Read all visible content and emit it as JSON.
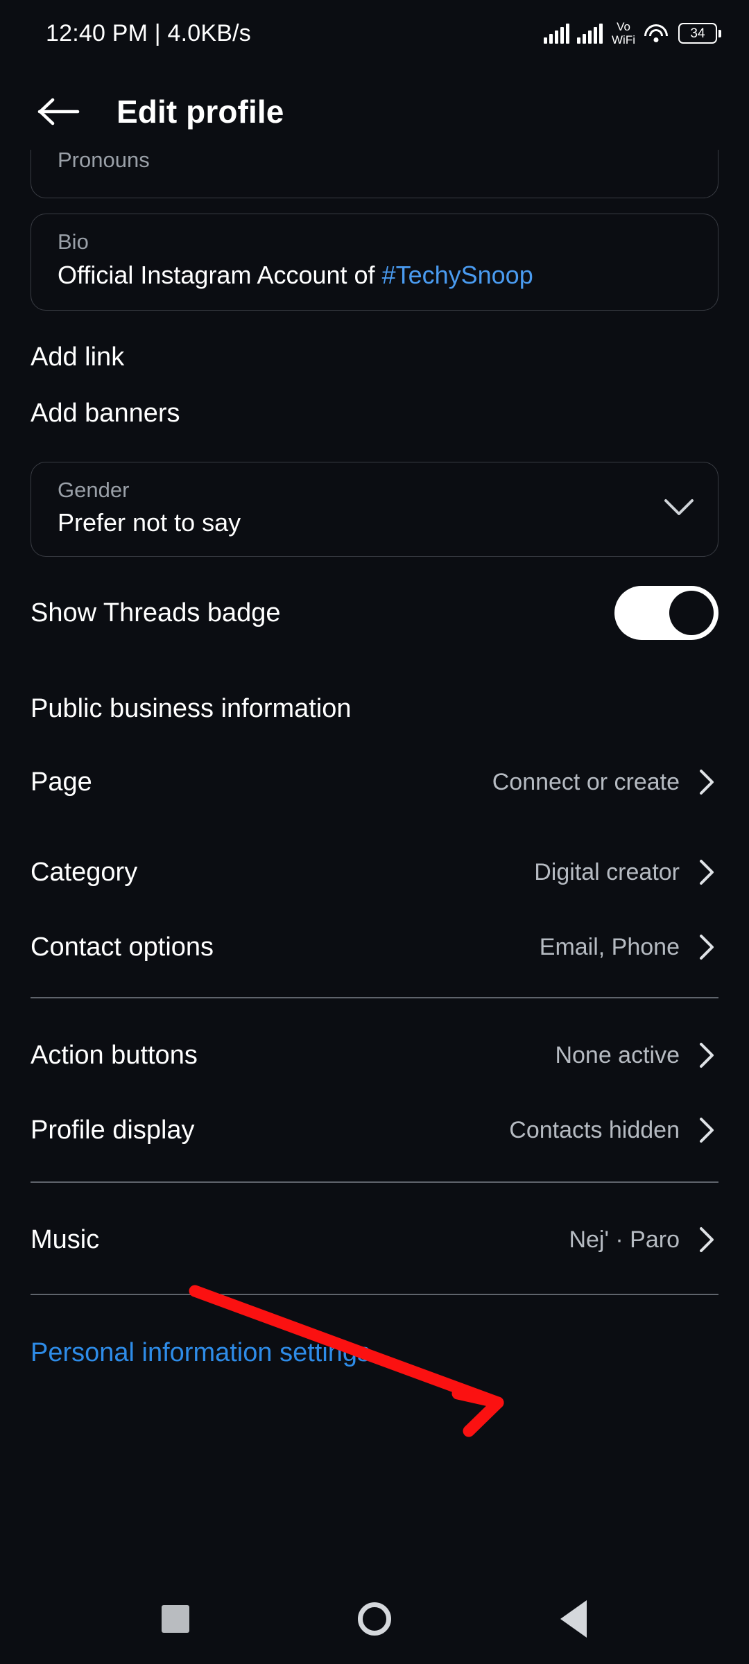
{
  "statusbar": {
    "left_text": "12:40 PM | 4.0KB/s",
    "volte_line1": "Vo",
    "volte_line2": "WiFi",
    "battery_level": "34"
  },
  "header": {
    "title": "Edit profile",
    "back_icon": "back-arrow-icon"
  },
  "form": {
    "pronouns": {
      "label": "Pronouns",
      "value": ""
    },
    "bio": {
      "label": "Bio",
      "value_text": "Official Instagram Account of ",
      "value_hashtag": "#TechySnoop",
      "hashtag_color": "#4a9bf0"
    },
    "add_link": "Add link",
    "add_banners": "Add banners",
    "gender": {
      "label": "Gender",
      "value": "Prefer not to say"
    },
    "threads_badge": {
      "label": "Show Threads badge",
      "state": "on"
    }
  },
  "business": {
    "section_title": "Public business information",
    "rows": [
      {
        "label": "Page",
        "value": "Connect or create"
      },
      {
        "label": "Category",
        "value": "Digital creator"
      },
      {
        "label": "Contact options",
        "value": "Email, Phone"
      }
    ]
  },
  "profile_tools": {
    "rows": [
      {
        "label": "Action buttons",
        "value": "None active"
      },
      {
        "label": "Profile display",
        "value": "Contacts hidden"
      }
    ]
  },
  "music": {
    "rows": [
      {
        "label": "Music",
        "value": "Nej' · Paro"
      }
    ]
  },
  "footer": {
    "personal_info_link": "Personal information settings",
    "link_color": "#2e8ce8"
  },
  "annotation": {
    "type": "arrow",
    "color": "#fb1111",
    "points_to": "music-row-value"
  },
  "navbar": {
    "recents": "recents-square-icon",
    "home": "home-circle-icon",
    "back": "back-triangle-icon"
  }
}
